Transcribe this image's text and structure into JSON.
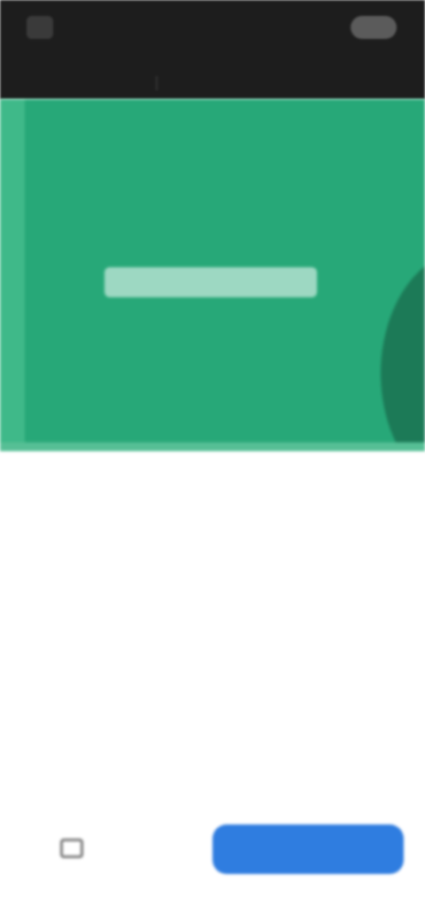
{
  "top_bar": {
    "logo_icon": "app-logo-icon",
    "logo_text": "",
    "action_label": ""
  },
  "tabs": [
    {
      "label": ""
    },
    {
      "label": ""
    }
  ],
  "hero": {
    "title": "",
    "color": "#27a878"
  },
  "content": {
    "heading": "",
    "paragraph": "",
    "bullets": [
      "",
      "",
      ""
    ]
  },
  "bottom_bar": {
    "secondary_icon": "checkbox-icon",
    "secondary_label": "",
    "primary_label": "",
    "primary_color": "#2f7de0"
  }
}
